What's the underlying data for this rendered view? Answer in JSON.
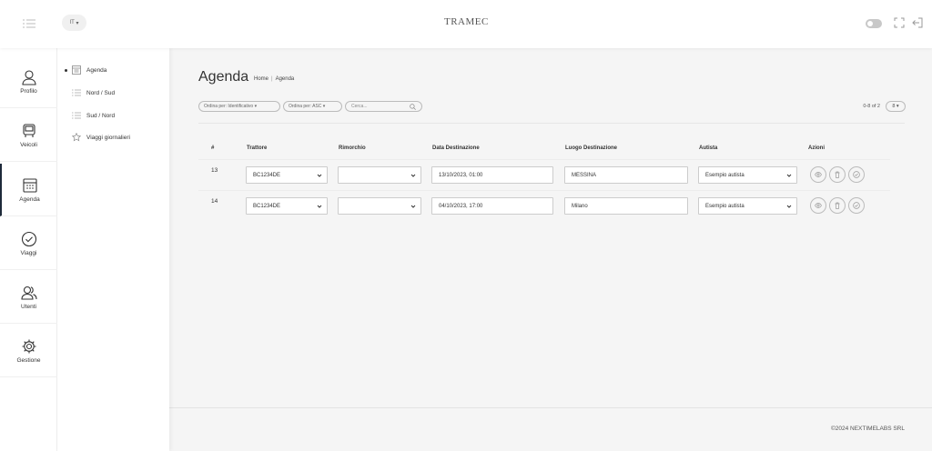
{
  "header": {
    "language": "IT",
    "logo": "TRAMEC",
    "icons": [
      "menu-icon",
      "toggle-icon",
      "fullscreen-icon",
      "logout-icon"
    ]
  },
  "rail": {
    "items": [
      {
        "label": "Profilo",
        "icon": "user-icon"
      },
      {
        "label": "Veicoli",
        "icon": "vehicle-icon"
      },
      {
        "label": "Agenda",
        "icon": "calendar-icon",
        "active": true
      },
      {
        "label": "Viaggi",
        "icon": "check-circle-icon"
      },
      {
        "label": "Utenti",
        "icon": "users-icon"
      },
      {
        "label": "Gestione",
        "icon": "gear-icon"
      }
    ]
  },
  "submenu": {
    "items": [
      {
        "label": "Agenda",
        "icon": "calendar-icon",
        "selected": true
      },
      {
        "label": "Nord / Sud",
        "icon": "list-icon"
      },
      {
        "label": "Sud / Nord",
        "icon": "list-icon"
      },
      {
        "label": "Viaggi giornalieri",
        "icon": "star-icon"
      }
    ]
  },
  "page": {
    "title": "Agenda",
    "breadcrumb": [
      "Home",
      "Agenda"
    ],
    "breadcrumb_sep": "|"
  },
  "filters": {
    "order_by": "Ordina per: Identificativo",
    "order_dir": "Ordina per: ASC",
    "search_placeholder": "Cerca...",
    "count": "0-8 of 2",
    "page_size": "8"
  },
  "table": {
    "columns": [
      "#",
      "Trattore",
      "Rimorchio",
      "Data Destinazione",
      "Luogo Destinazione",
      "Autista",
      "Azioni"
    ],
    "rows": [
      {
        "id": "13",
        "trattore": "BC1234DE",
        "rimorchio": "",
        "data": "13/10/2023, 01:00",
        "luogo": "MESSINA",
        "autista": "Esempio autista"
      },
      {
        "id": "14",
        "trattore": "BC1234DE",
        "rimorchio": "",
        "data": "04/10/2023, 17:00",
        "luogo": "Milano",
        "autista": "Esempio autista"
      }
    ]
  },
  "footer": {
    "text": "©2024 NEXTIMELABS SRL"
  },
  "colors": {
    "accent": "#1e2a3a",
    "background": "#f5f5f5",
    "panel": "#ffffff"
  }
}
